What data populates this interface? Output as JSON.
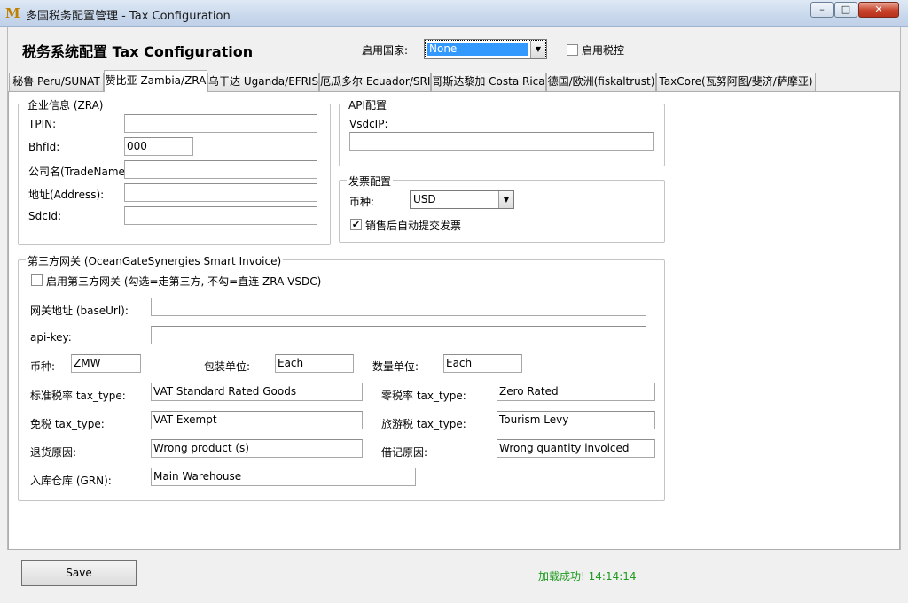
{
  "window": {
    "title": "多国税务配置管理 - Tax Configuration"
  },
  "header": {
    "title": "税务系统配置 Tax Configuration",
    "country_label": "启用国家:",
    "country_value": "None",
    "enable_tax_label": "启用税控",
    "enable_tax_checked": false
  },
  "tabs": [
    "秘鲁 Peru/SUNAT",
    "赞比亚 Zambia/ZRA",
    "乌干达 Uganda/EFRIS",
    "厄瓜多尔 Ecuador/SRI",
    "哥斯达黎加 Costa Rica",
    "德国/欧洲(fiskaltrust)",
    "TaxCore(瓦努阿图/斐济/萨摩亚)"
  ],
  "company": {
    "title": "企业信息 (ZRA)",
    "tpin_label": "TPIN:",
    "tpin_value": "",
    "bhfid_label": "BhfId:",
    "bhfid_value": "000",
    "tradename_label": "公司名(TradeName):",
    "tradename_value": "",
    "address_label": "地址(Address):",
    "address_value": "",
    "sdcid_label": "SdcId:",
    "sdcid_value": ""
  },
  "api": {
    "title": "API配置",
    "vsdcip_label": "VsdcIP:",
    "vsdcip_value": ""
  },
  "invoice": {
    "title": "发票配置",
    "currency_label": "币种:",
    "currency_value": "USD",
    "auto_submit_label": "销售后自动提交发票",
    "auto_submit_checked": true
  },
  "gateway": {
    "title": "第三方网关 (OceanGateSynergies Smart Invoice)",
    "enable_label": "启用第三方网关 (勾选=走第三方, 不勾=直连 ZRA VSDC)",
    "enable_checked": false,
    "baseurl_label": "网关地址 (baseUrl):",
    "baseurl_value": "",
    "apikey_label": "api-key:",
    "apikey_value": "",
    "currency_label": "币种:",
    "currency_value": "ZMW",
    "pkg_unit_label": "包装单位:",
    "pkg_unit_value": "Each",
    "qty_unit_label": "数量单位:",
    "qty_unit_value": "Each",
    "std_tax_label": "标准税率 tax_type:",
    "std_tax_value": "VAT Standard Rated Goods",
    "zero_tax_label": "零税率 tax_type:",
    "zero_tax_value": "Zero Rated",
    "exempt_tax_label": "免税 tax_type:",
    "exempt_tax_value": "VAT Exempt",
    "tourism_tax_label": "旅游税 tax_type:",
    "tourism_tax_value": "Tourism Levy",
    "refund_reason_label": "退货原因:",
    "refund_reason_value": "Wrong product (s)",
    "credit_reason_label": "借记原因:",
    "credit_reason_value": "Wrong quantity invoiced",
    "warehouse_label": "入库仓库 (GRN):",
    "warehouse_value": "Main Warehouse"
  },
  "footer": {
    "save_label": "Save",
    "status_text": "加载成功! 14:14:14"
  },
  "icons": {
    "app": "M-logo-icon",
    "minimize": "minimize-icon",
    "maximize": "maximize-icon",
    "close": "close-icon"
  },
  "colors": {
    "status_ok": "#1f9b1f",
    "selection": "#3399ff"
  },
  "window_glyphs": {
    "minimize": "–",
    "maximize": "□",
    "close": "✕",
    "app": "M",
    "dropdown": "▼",
    "check": "✔"
  }
}
